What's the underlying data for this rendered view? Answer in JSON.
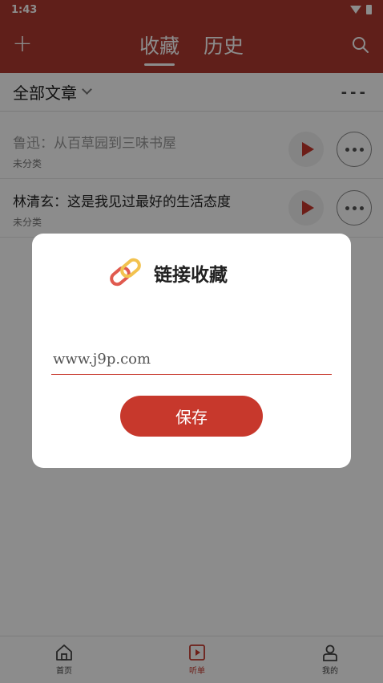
{
  "status": {
    "time": "1:43"
  },
  "header": {
    "add_icon": "plus-icon",
    "tabs": [
      {
        "label": "收藏",
        "active": true
      },
      {
        "label": "历史",
        "active": false
      }
    ],
    "search_icon": "search-icon",
    "bg_color": "#b03a30"
  },
  "filter": {
    "label": "全部文章",
    "more_label": "---"
  },
  "articles": [
    {
      "title": "鲁迅：从百草园到三味书屋",
      "category": "未分类"
    },
    {
      "title": "林清玄：这是我见过最好的生活态度",
      "category": "未分类"
    }
  ],
  "dialog": {
    "title": "链接收藏",
    "url_value": "www.j9p.com",
    "save_label": "保存",
    "accent": "#c7382c"
  },
  "bottom_nav": [
    {
      "label": "首页",
      "icon": "home-icon",
      "active": false
    },
    {
      "label": "听单",
      "icon": "play-list-icon",
      "active": true
    },
    {
      "label": "我的",
      "icon": "user-icon",
      "active": false
    }
  ]
}
